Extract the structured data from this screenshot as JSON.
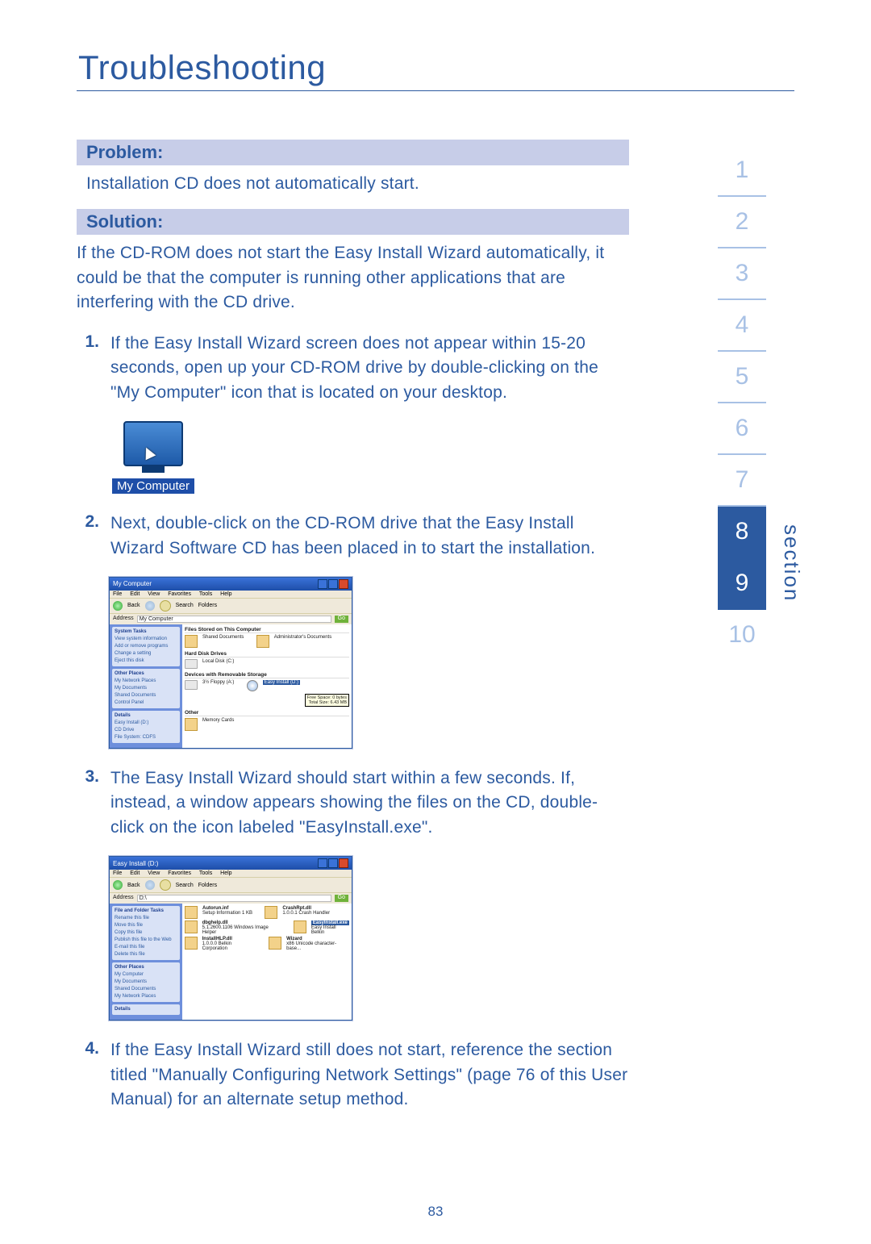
{
  "title": "Troubleshooting",
  "problem_heading": "Problem:",
  "problem_text": "Installation CD does not automatically start.",
  "solution_heading": "Solution:",
  "solution_intro": "If the CD-ROM does not start the Easy Install Wizard automatically, it could be that the computer is running other applications that are interfering with the CD drive.",
  "steps": {
    "s1": {
      "num": "1.",
      "text": "If the Easy Install Wizard screen does not appear within 15-20 seconds, open up your CD-ROM drive by double-clicking on the \"My Computer\" icon that is located on your desktop."
    },
    "s2": {
      "num": "2.",
      "text": "Next, double-click on the CD-ROM drive that the Easy Install Wizard Software CD has been placed in to start the installation."
    },
    "s3": {
      "num": "3.",
      "text": "The Easy Install Wizard should start within a few seconds. If, instead, a window appears showing the files on the CD, double-click on the icon labeled \"EasyInstall.exe\"."
    },
    "s4": {
      "num": "4.",
      "text": "If the Easy Install Wizard still does not start, reference the section titled \"Manually Configuring Network Settings\" (page 76 of this User Manual) for an alternate setup method."
    }
  },
  "mycomputer_label": "My Computer",
  "xp": {
    "menus": {
      "file": "File",
      "edit": "Edit",
      "view": "View",
      "fav": "Favorites",
      "tools": "Tools",
      "help": "Help"
    },
    "toolbar": {
      "back": "Back",
      "search": "Search",
      "folders": "Folders"
    },
    "addr_label": "Address",
    "go": "Go"
  },
  "win1": {
    "title": "My Computer",
    "addr": "My Computer",
    "side": {
      "g1_title": "System Tasks",
      "g1_a": "View system information",
      "g1_b": "Add or remove programs",
      "g1_c": "Change a setting",
      "g1_d": "Eject this disk",
      "g2_title": "Other Places",
      "g2_a": "My Network Places",
      "g2_b": "My Documents",
      "g2_c": "Shared Documents",
      "g2_d": "Control Panel",
      "g3_title": "Details",
      "g3_a": "Easy Install (D:)",
      "g3_b": "CD Drive",
      "g3_c": "File System: CDFS"
    },
    "main": {
      "h1": "Files Stored on This Computer",
      "i1": "Shared Documents",
      "i2": "Administrator's Documents",
      "h2": "Hard Disk Drives",
      "i3": "Local Disk (C:)",
      "h3": "Devices with Removable Storage",
      "i4": "3½ Floppy (A:)",
      "i5": "Easy Install (D:)",
      "tip1": "Free Space: 0 bytes",
      "tip2": "Total Size: 6.43 MB",
      "h4": "Other",
      "i6": "Memory Cards"
    }
  },
  "win2": {
    "title": "Easy Install (D:)",
    "addr": "D:\\",
    "side": {
      "g1_title": "File and Folder Tasks",
      "g1_a": "Rename this file",
      "g1_b": "Move this file",
      "g1_c": "Copy this file",
      "g1_d": "Publish this file to the Web",
      "g1_e": "E-mail this file",
      "g1_f": "Delete this file",
      "g2_title": "Other Places",
      "g2_a": "My Computer",
      "g2_b": "My Documents",
      "g2_c": "Shared Documents",
      "g2_d": "My Network Places",
      "g3_title": "Details"
    },
    "main": {
      "f1_name": "Autorun.inf",
      "f1_meta": "Setup Information\n1 KB",
      "f2_name": "CrashRpt.dll",
      "f2_meta": "1.0.0.1\nCrash Handler",
      "f3_name": "dbghelp.dll",
      "f3_meta": "5.1.2600.1106\nWindows Image Helper",
      "f4_name": "EasyInstall.exe",
      "f4_meta": "Easy Install\nBelkin",
      "f5_name": "InstallHLP.dll",
      "f5_meta": "1.0.0.0\nBelkin Corporation",
      "f6_name": "Wizard",
      "f6_meta": "x86 Unicode character-base..."
    }
  },
  "nav": {
    "n1": "1",
    "n2": "2",
    "n3": "3",
    "n4": "4",
    "n5": "5",
    "n6": "6",
    "n7": "7",
    "n8": "8",
    "n9": "9",
    "n10": "10",
    "label": "section"
  },
  "page_number": "83"
}
